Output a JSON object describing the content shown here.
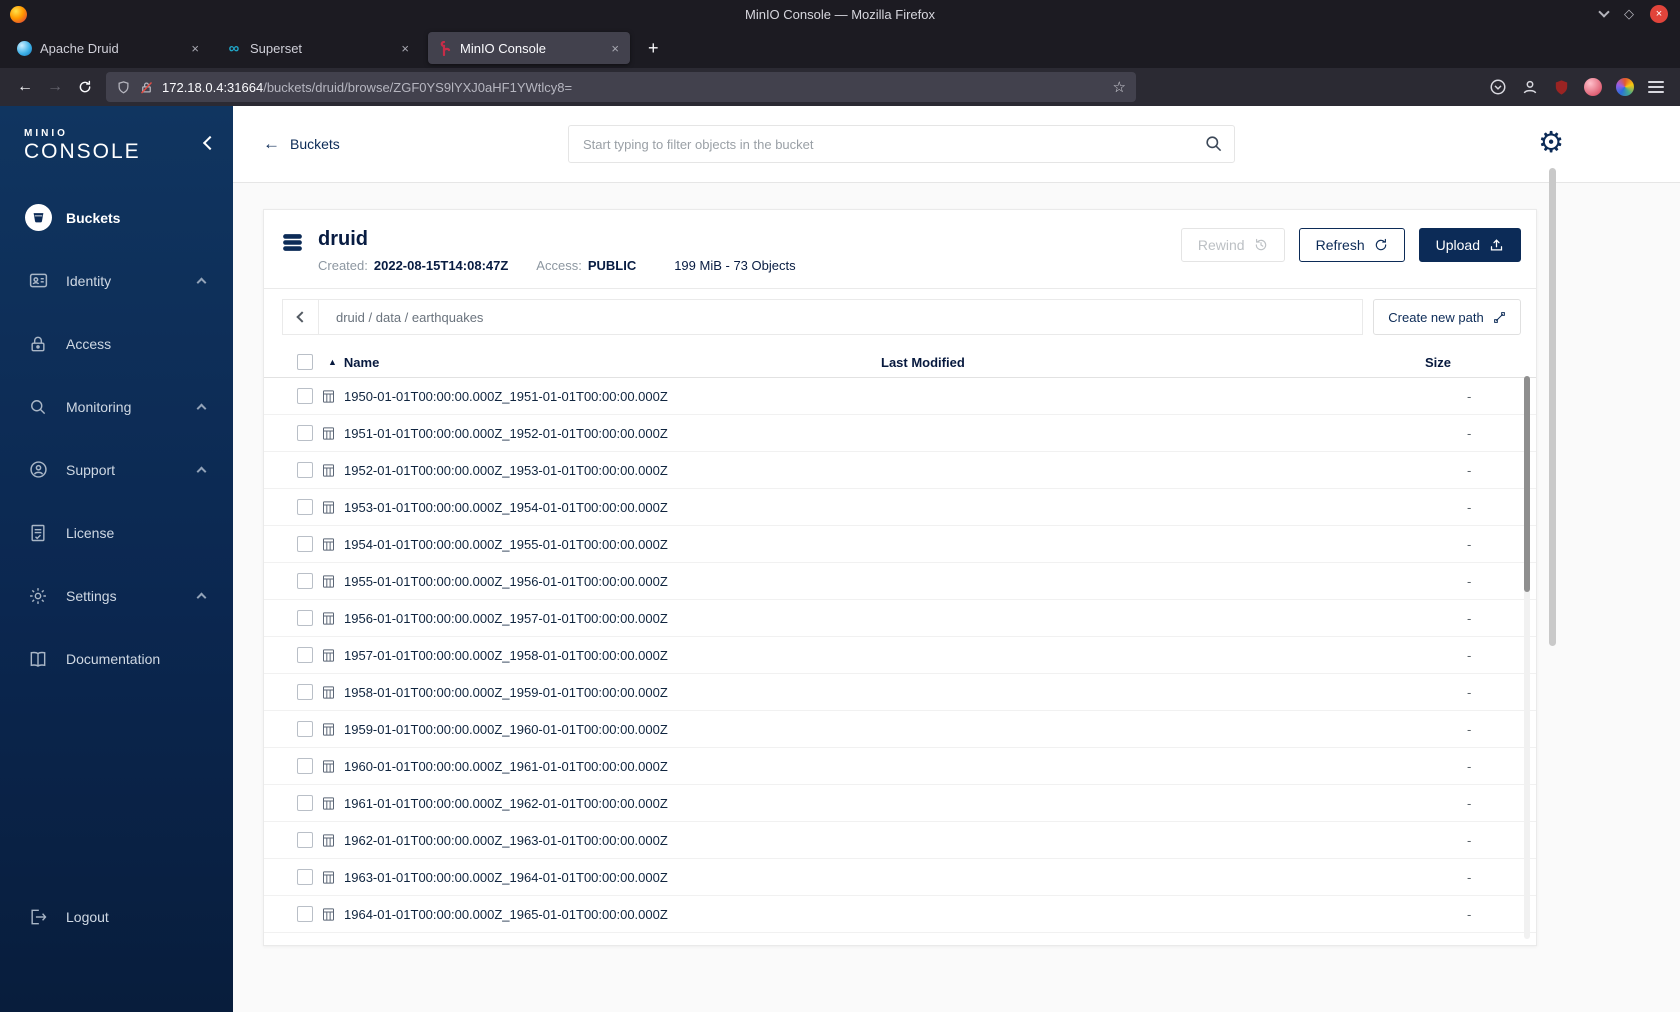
{
  "window": {
    "title": "MinIO Console — Mozilla Firefox"
  },
  "glyphs": {
    "back": "←",
    "forward": "→",
    "star": "☆",
    "gear": "⚙",
    "plus": "+",
    "close_x": "×",
    "diamond": "◇",
    "sort_asc": "▲",
    "infinity": "∞"
  },
  "colors": {
    "navy": "#0c2b57",
    "dark_navy": "#081C42",
    "close_red": "#e1443b",
    "sidebar_top": "#103560",
    "sidebar_bottom": "#081d3c"
  },
  "tabs": [
    {
      "label": "Apache Druid"
    },
    {
      "label": "Superset"
    },
    {
      "label": "MinIO Console",
      "active": true
    }
  ],
  "toolbar": {
    "url_host": "172.18.0.4:31664",
    "url_path": "/buckets/druid/browse/ZGF0YS9lYXJ0aHF1YWtlcy8="
  },
  "sidebar": {
    "logo_top": "MINIO",
    "logo_bottom": "CONSOLE",
    "items": [
      {
        "label": "Buckets",
        "active": true
      },
      {
        "label": "Identity",
        "expandable": true
      },
      {
        "label": "Access"
      },
      {
        "label": "Monitoring",
        "expandable": true
      },
      {
        "label": "Support",
        "expandable": true
      },
      {
        "label": "License"
      },
      {
        "label": "Settings",
        "expandable": true
      },
      {
        "label": "Documentation"
      }
    ],
    "logout_label": "Logout"
  },
  "header": {
    "back_label": "Buckets",
    "search_placeholder": "Start typing to filter objects in the bucket"
  },
  "bucket": {
    "name": "druid",
    "created_label": "Created:",
    "created_value": "2022-08-15T14:08:47Z",
    "access_label": "Access:",
    "access_value": "PUBLIC",
    "stats": "199 MiB - 73 Objects",
    "rewind_label": "Rewind",
    "refresh_label": "Refresh",
    "upload_label": "Upload"
  },
  "path_bar": {
    "breadcrumb": "druid / data / earthquakes",
    "create_path_label": "Create new path"
  },
  "table": {
    "columns": {
      "name": "Name",
      "modified": "Last Modified",
      "size": "Size"
    },
    "rows": [
      {
        "name": "1950-01-01T00:00:00.000Z_1951-01-01T00:00:00.000Z",
        "size": "-"
      },
      {
        "name": "1951-01-01T00:00:00.000Z_1952-01-01T00:00:00.000Z",
        "size": "-"
      },
      {
        "name": "1952-01-01T00:00:00.000Z_1953-01-01T00:00:00.000Z",
        "size": "-"
      },
      {
        "name": "1953-01-01T00:00:00.000Z_1954-01-01T00:00:00.000Z",
        "size": "-"
      },
      {
        "name": "1954-01-01T00:00:00.000Z_1955-01-01T00:00:00.000Z",
        "size": "-"
      },
      {
        "name": "1955-01-01T00:00:00.000Z_1956-01-01T00:00:00.000Z",
        "size": "-"
      },
      {
        "name": "1956-01-01T00:00:00.000Z_1957-01-01T00:00:00.000Z",
        "size": "-"
      },
      {
        "name": "1957-01-01T00:00:00.000Z_1958-01-01T00:00:00.000Z",
        "size": "-"
      },
      {
        "name": "1958-01-01T00:00:00.000Z_1959-01-01T00:00:00.000Z",
        "size": "-"
      },
      {
        "name": "1959-01-01T00:00:00.000Z_1960-01-01T00:00:00.000Z",
        "size": "-"
      },
      {
        "name": "1960-01-01T00:00:00.000Z_1961-01-01T00:00:00.000Z",
        "size": "-"
      },
      {
        "name": "1961-01-01T00:00:00.000Z_1962-01-01T00:00:00.000Z",
        "size": "-"
      },
      {
        "name": "1962-01-01T00:00:00.000Z_1963-01-01T00:00:00.000Z",
        "size": "-"
      },
      {
        "name": "1963-01-01T00:00:00.000Z_1964-01-01T00:00:00.000Z",
        "size": "-"
      },
      {
        "name": "1964-01-01T00:00:00.000Z_1965-01-01T00:00:00.000Z",
        "size": "-"
      }
    ]
  }
}
